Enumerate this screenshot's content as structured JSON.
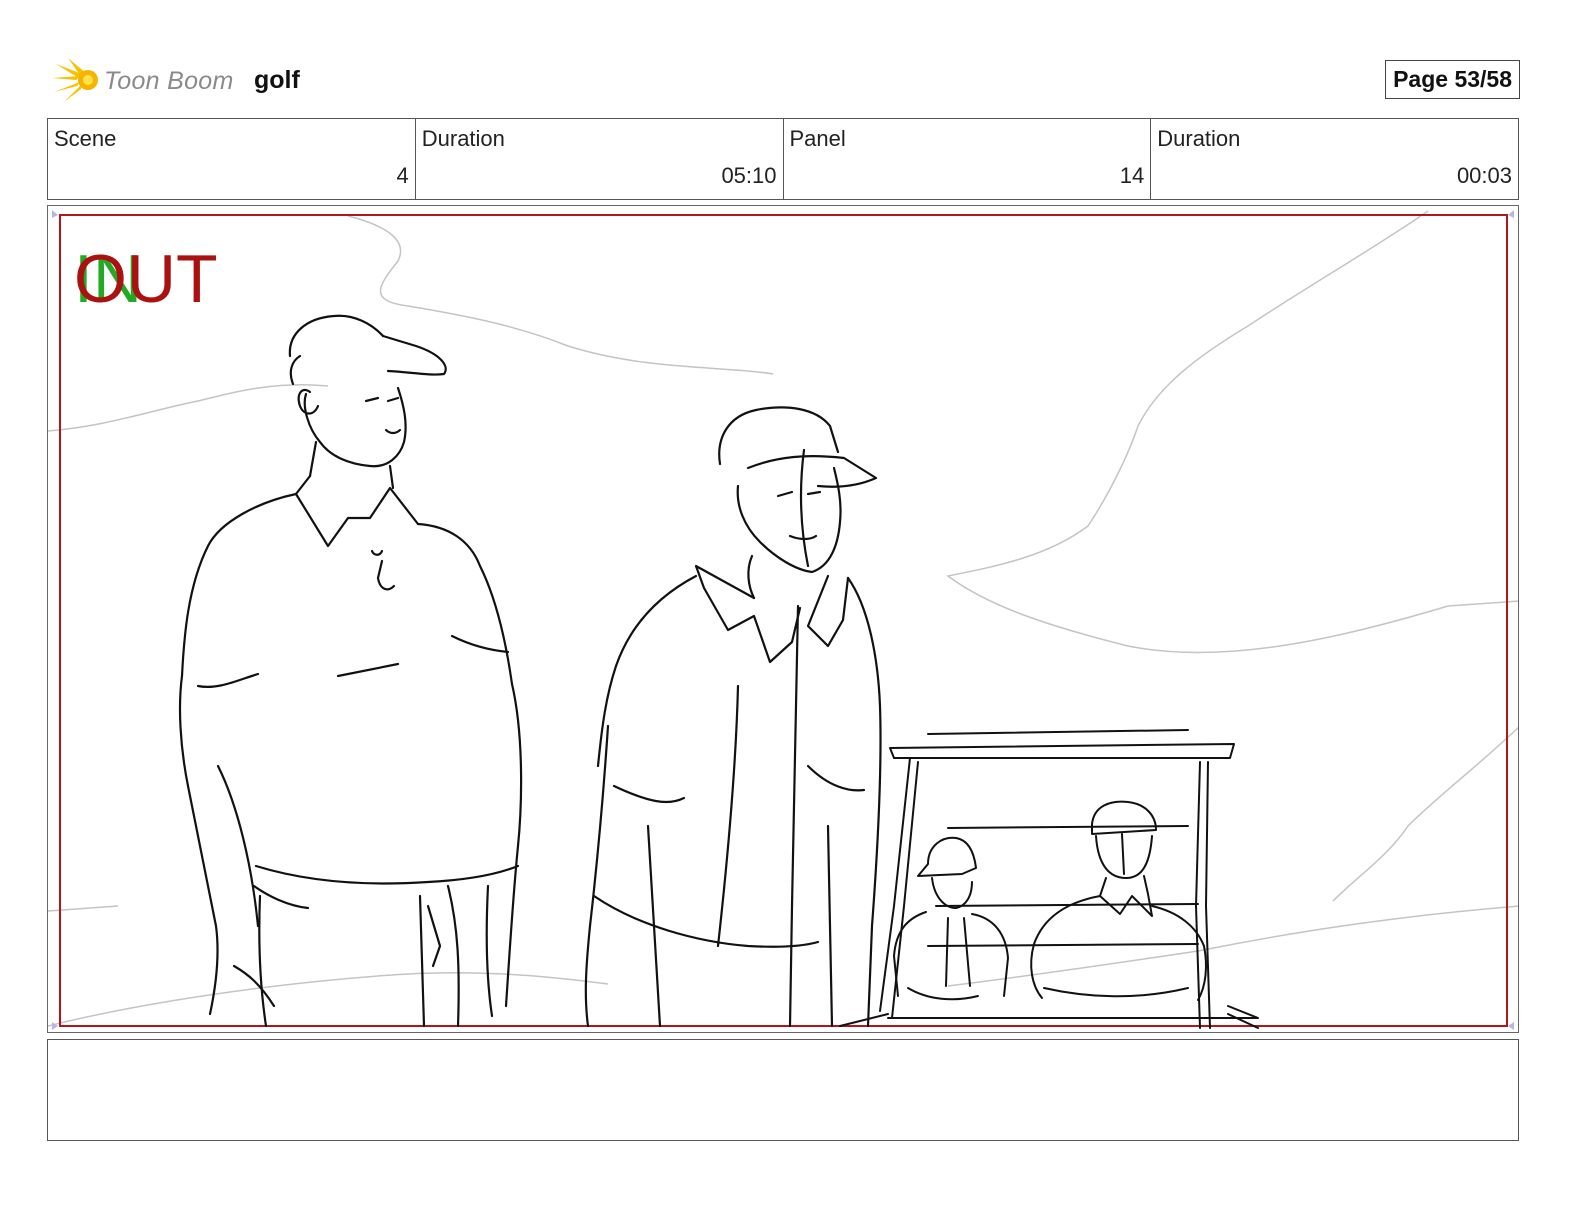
{
  "header": {
    "logo_text": "Toon Boom",
    "project_name": "golf",
    "page_label": "Page 53/58"
  },
  "info": {
    "scene_label": "Scene",
    "scene_value": "4",
    "scene_duration_label": "Duration",
    "scene_duration_value": "05:10",
    "panel_label": "Panel",
    "panel_value": "14",
    "panel_duration_label": "Duration",
    "panel_duration_value": "00:03"
  },
  "panel": {
    "in_text": "IN",
    "out_text": "OUT",
    "in_color": "#22aa22",
    "out_color": "#aa1111",
    "frame_color": "#b01818"
  },
  "notes": {
    "text": ""
  }
}
